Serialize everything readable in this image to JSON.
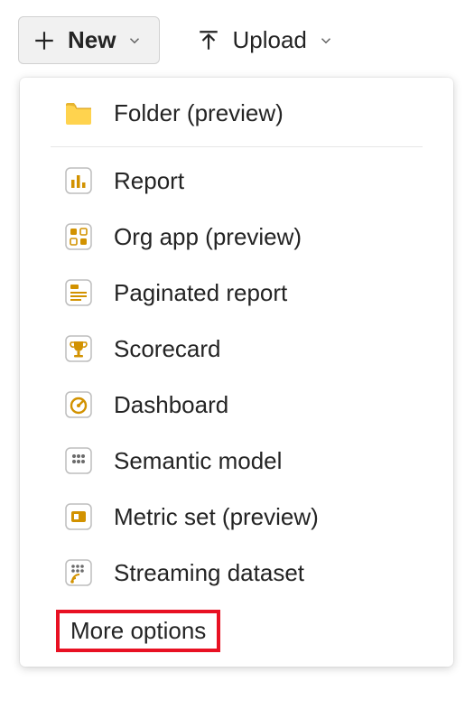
{
  "toolbar": {
    "new_label": "New",
    "upload_label": "Upload"
  },
  "menu": {
    "items": [
      {
        "label": "Folder (preview)",
        "icon": "folder-icon"
      },
      {
        "label": "Report",
        "icon": "report-icon"
      },
      {
        "label": "Org app (preview)",
        "icon": "org-app-icon"
      },
      {
        "label": "Paginated report",
        "icon": "paginated-report-icon"
      },
      {
        "label": "Scorecard",
        "icon": "scorecard-icon"
      },
      {
        "label": "Dashboard",
        "icon": "dashboard-icon"
      },
      {
        "label": "Semantic model",
        "icon": "semantic-model-icon"
      },
      {
        "label": "Metric set (preview)",
        "icon": "metric-set-icon"
      },
      {
        "label": "Streaming dataset",
        "icon": "streaming-dataset-icon"
      }
    ],
    "more_label": "More options"
  },
  "colors": {
    "accent": "#d29200",
    "brand": "#c77f00",
    "highlight": "#e81123"
  }
}
